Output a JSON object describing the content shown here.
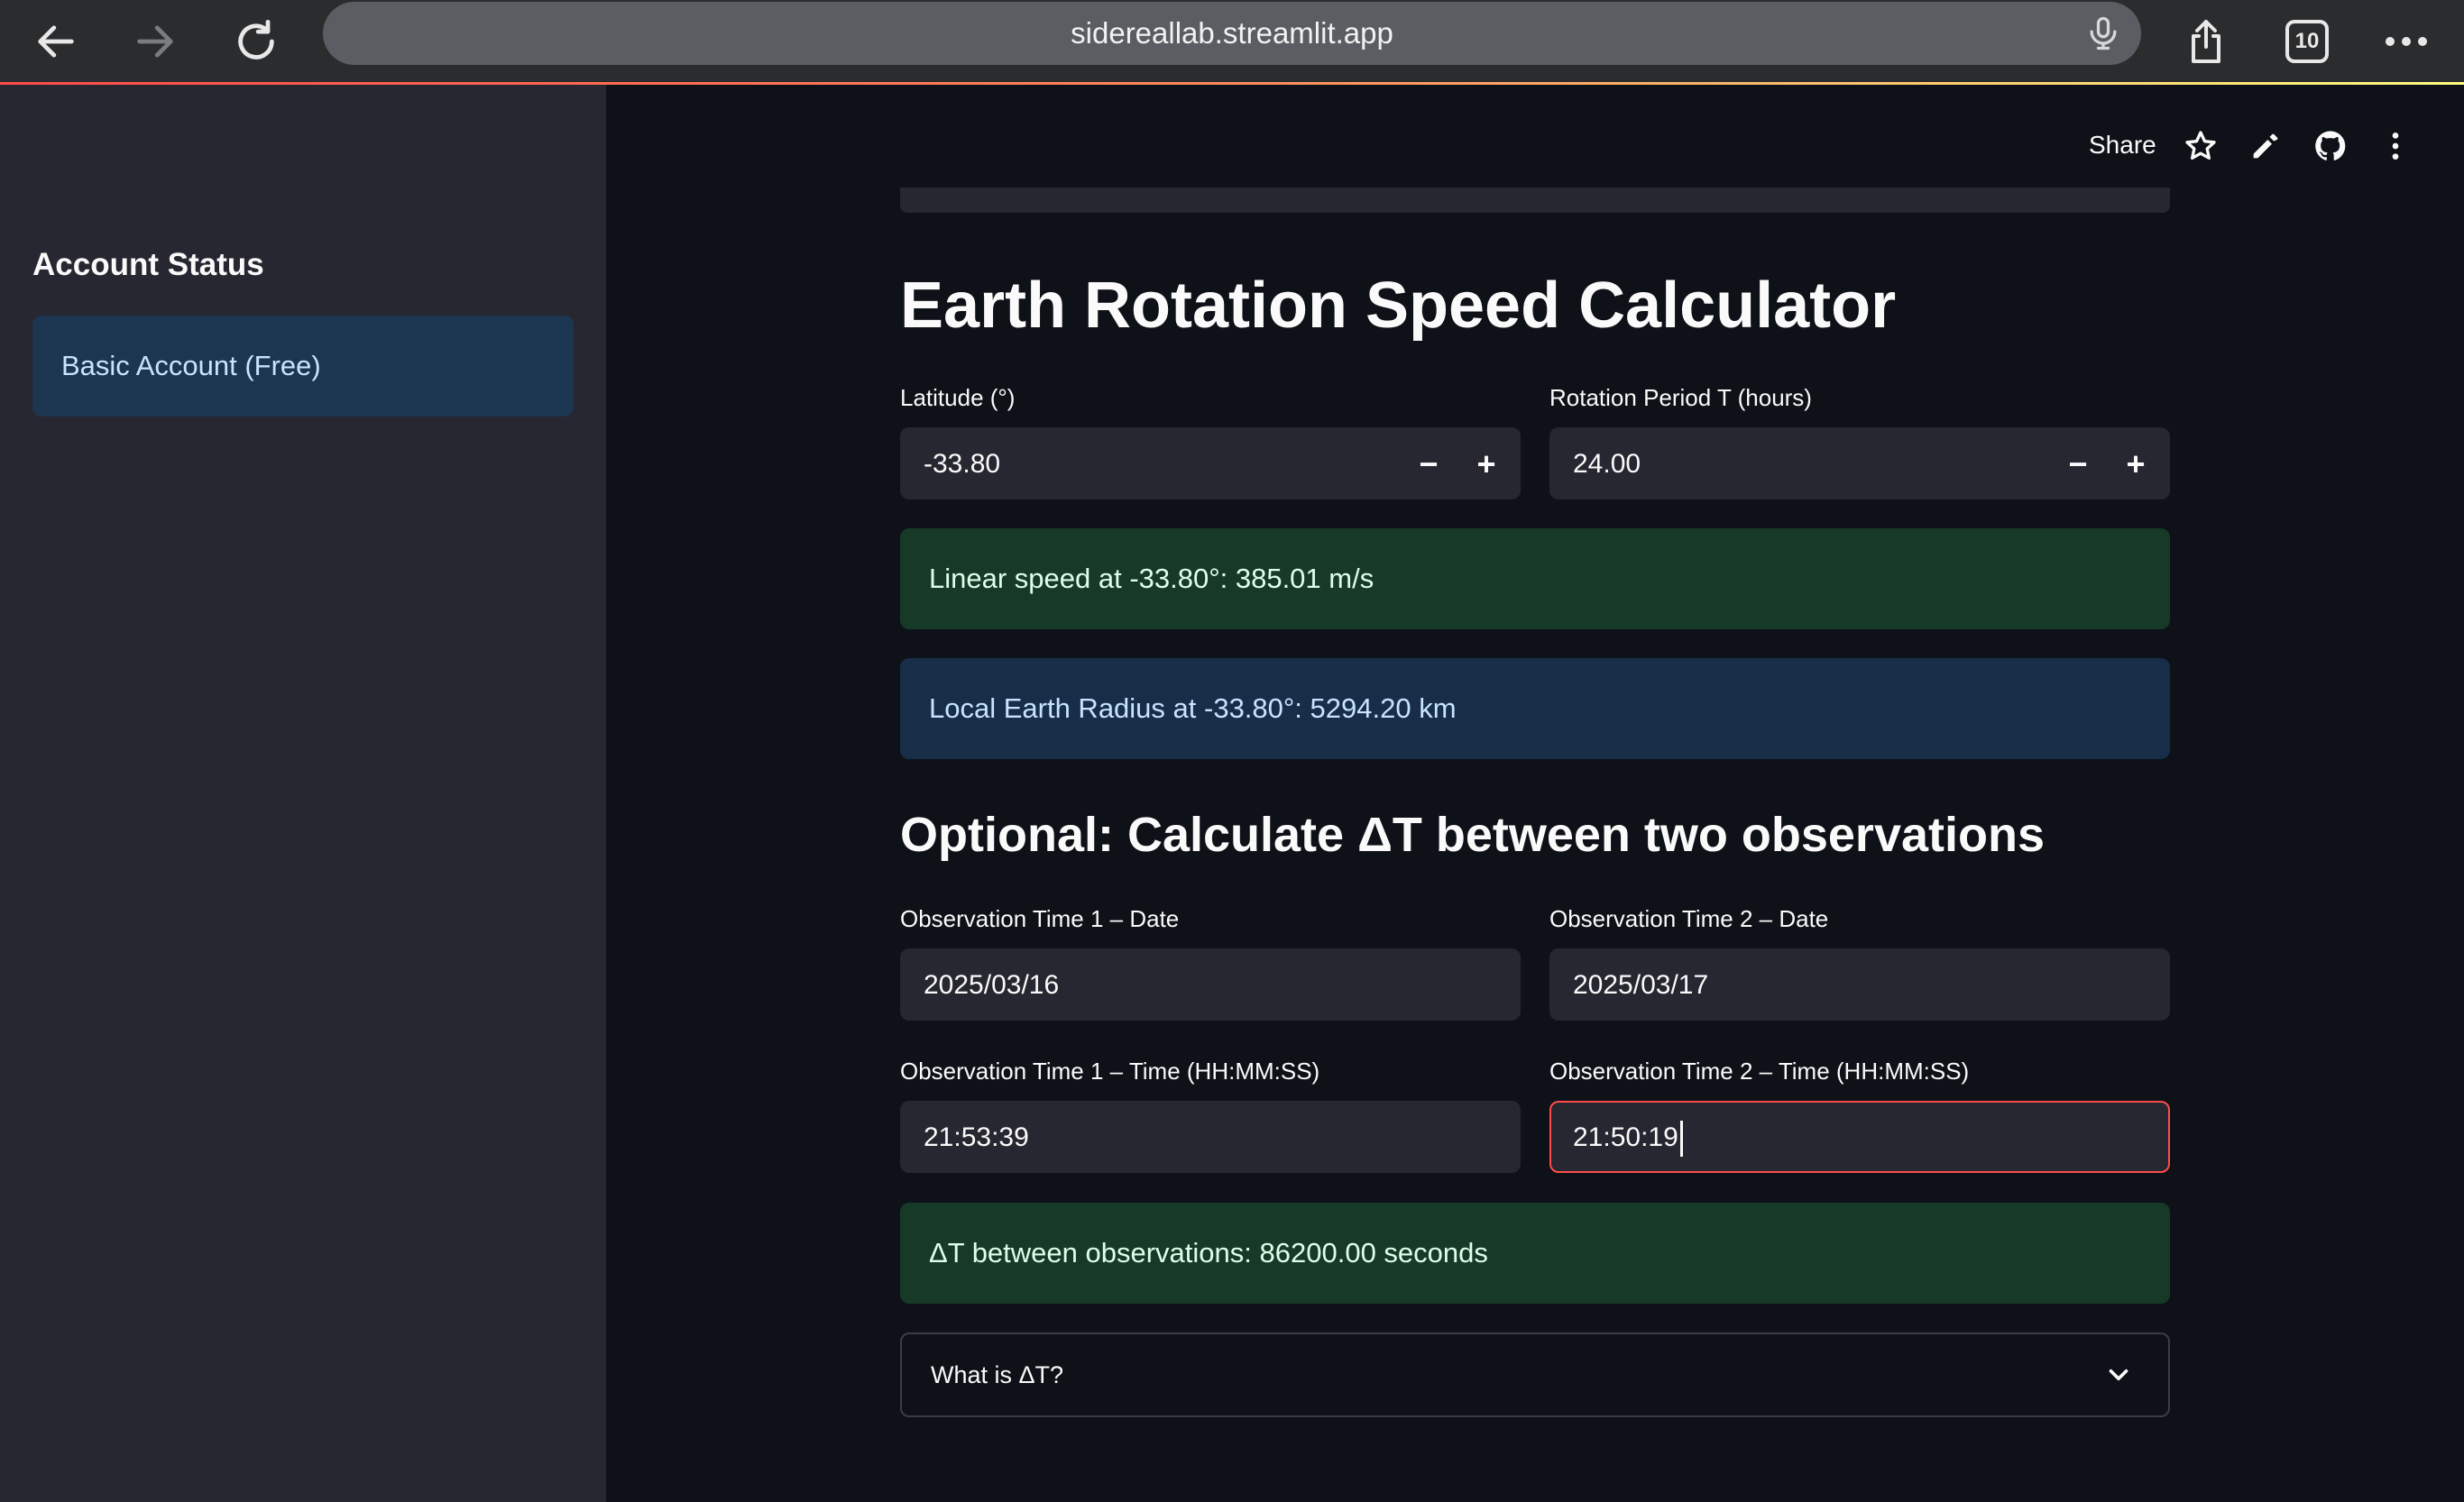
{
  "browser": {
    "url": "sidereallab.streamlit.app",
    "tab_count": "10",
    "icons": {
      "back": "arrow-left-icon",
      "forward": "arrow-right-icon",
      "reload": "reload-icon",
      "mic": "microphone-icon",
      "share": "share-icon",
      "tabs": "tabs-icon",
      "more": "more-icon"
    }
  },
  "sidebar": {
    "title": "Account Status",
    "account": "Basic Account (Free)"
  },
  "toolbar": {
    "share_label": "Share"
  },
  "main": {
    "title": "Earth Rotation Speed Calculator",
    "latitude": {
      "label": "Latitude (°)",
      "value": "-33.80"
    },
    "period": {
      "label": "Rotation Period T (hours)",
      "value": "24.00"
    },
    "stepper": {
      "minus": "−",
      "plus": "+"
    },
    "linear_speed": "Linear speed at -33.80°: 385.01 m/s",
    "local_radius": "Local Earth Radius at -33.80°: 5294.20 km",
    "section_title": "Optional: Calculate ΔT between two observations",
    "obs1_date": {
      "label": "Observation Time 1 – Date",
      "value": "2025/03/16"
    },
    "obs2_date": {
      "label": "Observation Time 2 – Date",
      "value": "2025/03/17"
    },
    "obs1_time": {
      "label": "Observation Time 1 – Time (HH:MM:SS)",
      "value": "21:53:39"
    },
    "obs2_time": {
      "label": "Observation Time 2 – Time (HH:MM:SS)",
      "value": "21:50:19"
    },
    "delta_result": "ΔT between observations: 86200.00 seconds",
    "expander_label": "What is ΔT?"
  },
  "colors": {
    "background": "#0e1117",
    "sidebar": "#262730",
    "accent": "#ff4b4b",
    "success_bg": "#173928",
    "info_bg": "#172d48"
  }
}
